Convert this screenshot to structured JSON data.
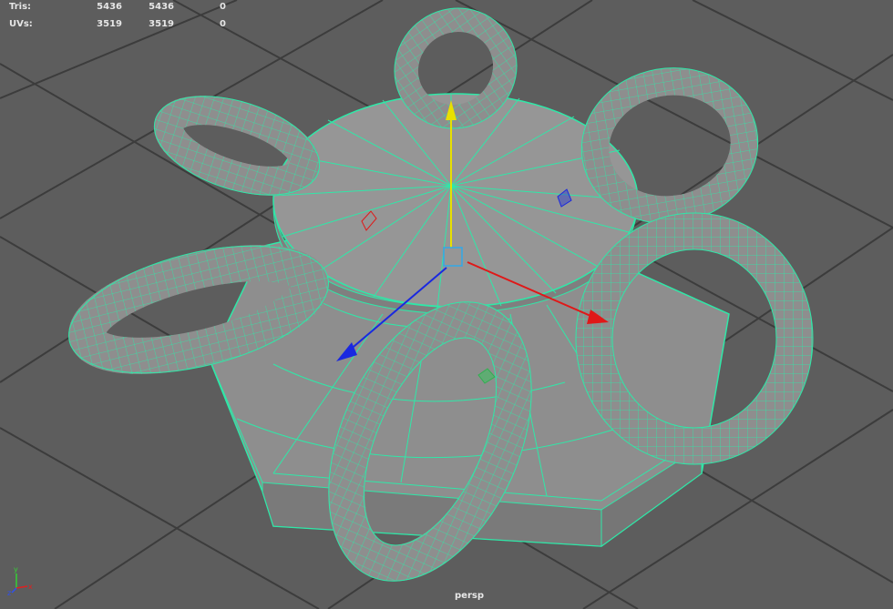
{
  "hud": {
    "rows": [
      {
        "label": "Tris:",
        "values": [
          "5436",
          "5436",
          "0"
        ]
      },
      {
        "label": "UVs:",
        "values": [
          "3519",
          "3519",
          "0"
        ]
      }
    ]
  },
  "viewport": {
    "camera": "persp",
    "axes": {
      "x": "x",
      "y": "y",
      "z": "z"
    }
  },
  "scene": {
    "wire_color": "#2fe8a8",
    "mesh_color": "#8e8e8e",
    "grid_color": "#3c3c3c",
    "background_color": "#5d5d5d",
    "manipulator": {
      "x_color": "#e01818",
      "y_color": "#e8e000",
      "z_color": "#1a28e0",
      "center_color": "#30a8e8"
    }
  }
}
